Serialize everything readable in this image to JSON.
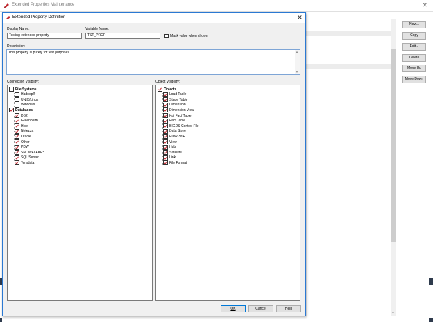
{
  "background_window": {
    "title": "Extended Properties Maintenance",
    "buttons": [
      "New...",
      "Copy",
      "Edit...",
      "Delete",
      "Move Up",
      "Move Down"
    ]
  },
  "dialog": {
    "title": "Extended Property Definition",
    "display_name": {
      "label": "Display Name:",
      "value": "Testing extended property"
    },
    "variable_name": {
      "label": "Variable Name:",
      "value": "TST_PROP"
    },
    "mask_value": {
      "label": "Mask value when shown",
      "checked": false
    },
    "description": {
      "label": "Description:",
      "value": "This property is purely for test purposes."
    },
    "connection_visibility": {
      "label": "Connection Visibility:",
      "groups": [
        {
          "name": "File Systems",
          "checked": false,
          "items": [
            {
              "name": "Hadoop®",
              "checked": false
            },
            {
              "name": "UNIX/Linux",
              "checked": false
            },
            {
              "name": "Windows",
              "checked": false
            }
          ]
        },
        {
          "name": "Databases",
          "checked": true,
          "items": [
            {
              "name": "DB2",
              "checked": true
            },
            {
              "name": "Greenplum",
              "checked": true
            },
            {
              "name": "Hive",
              "checked": true
            },
            {
              "name": "Netezza",
              "checked": true
            },
            {
              "name": "Oracle",
              "checked": true
            },
            {
              "name": "Other",
              "checked": true
            },
            {
              "name": "PDW",
              "checked": true
            },
            {
              "name": "SNOWFLAKE*",
              "checked": true
            },
            {
              "name": "SQL Server",
              "checked": true
            },
            {
              "name": "Teradata",
              "checked": true
            }
          ]
        }
      ]
    },
    "object_visibility": {
      "label": "Object Visibility:",
      "groups": [
        {
          "name": "Objects",
          "checked": true,
          "items": [
            {
              "name": "Load Table",
              "checked": true
            },
            {
              "name": "Stage Table",
              "checked": true
            },
            {
              "name": "Dimension",
              "checked": true
            },
            {
              "name": "Dimension View",
              "checked": true
            },
            {
              "name": "Kpi Fact Table",
              "checked": true
            },
            {
              "name": "Fact Table",
              "checked": true
            },
            {
              "name": "BIGDS Control File",
              "checked": true
            },
            {
              "name": "Data Store",
              "checked": true
            },
            {
              "name": "EDW 3NF",
              "checked": true
            },
            {
              "name": "View",
              "checked": true
            },
            {
              "name": "Hub",
              "checked": true
            },
            {
              "name": "Satellite",
              "checked": true
            },
            {
              "name": "Link",
              "checked": true
            },
            {
              "name": "File Format",
              "checked": true
            }
          ]
        }
      ]
    },
    "buttons": {
      "ok": "OK",
      "cancel": "Cancel",
      "help": "Help"
    }
  },
  "colors": {
    "accent": "#0078d7",
    "titlebar_border": "#2b79d3",
    "check": "#c0262d",
    "button": "#e1e1e1"
  }
}
